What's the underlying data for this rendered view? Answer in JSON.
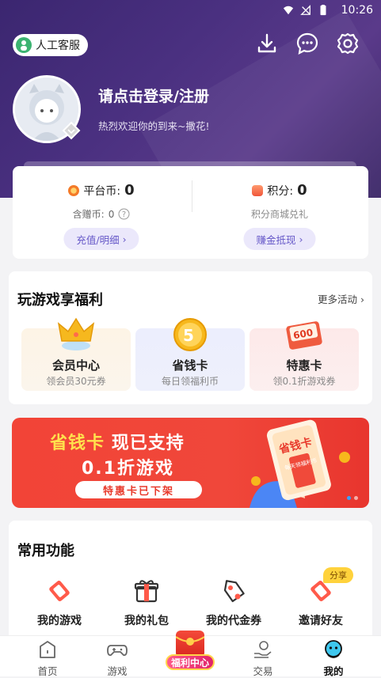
{
  "status_bar": {
    "time": "10:26"
  },
  "header": {
    "customer_service_label": "人工客服",
    "login_title": "请点击登录/注册",
    "login_subtitle": "热烈欢迎你的到来~撒花!"
  },
  "wallet": {
    "platform_coin_label": "平台币:",
    "platform_coin_value": "0",
    "gift_coin_label": "含赠币:",
    "gift_coin_value": "0",
    "recharge_button": "充值/明细",
    "points_label": "积分:",
    "points_value": "0",
    "points_sub": "积分商城兑礼",
    "earn_button": "赚金抵现"
  },
  "benefits": {
    "title": "玩游戏享福利",
    "more": "更多活动",
    "items": [
      {
        "name": "会员中心",
        "desc": "领会员30元券"
      },
      {
        "name": "省钱卡",
        "desc": "每日领福利币",
        "icon_text": "5"
      },
      {
        "name": "特惠卡",
        "desc": "领0.1折游戏券",
        "icon_text": "600"
      }
    ]
  },
  "banner": {
    "line1_highlight": "省钱卡",
    "line1_rest": "现已支持",
    "line2": "0.1折游戏",
    "tag": "特惠卡已下架",
    "card_title": "省钱卡",
    "card_sub": "每天领福利币"
  },
  "functions": {
    "title": "常用功能",
    "items": [
      {
        "label": "我的游戏"
      },
      {
        "label": "我的礼包"
      },
      {
        "label": "我的代金券"
      },
      {
        "label": "邀请好友"
      }
    ],
    "share_badge": "分享"
  },
  "tabbar": {
    "items": [
      {
        "label": "首页"
      },
      {
        "label": "游戏"
      },
      {
        "label": "福利中心"
      },
      {
        "label": "交易"
      },
      {
        "label": "我的"
      }
    ]
  }
}
